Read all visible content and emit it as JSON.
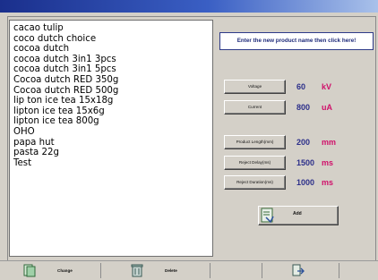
{
  "products": [
    "cacao tulip",
    "coco dutch choice",
    "cocoa dutch",
    "cocoa dutch 3in1 3pcs",
    "cocoa dutch 3in1 5pcs",
    "Cocoa dutch RED 350g",
    "Cocoa dutch RED 500g",
    "lip ton ice tea 15x18g",
    "lipton ice tea 15x6g",
    "lipton ice tea 800g",
    "OHO",
    "papa hut",
    "pasta 22g",
    "Test"
  ],
  "name_input": {
    "prompt": "Enter the new product name then click here!"
  },
  "params": {
    "voltage": {
      "label": "Voltage",
      "value": "60",
      "unit": "kV"
    },
    "current": {
      "label": "Current",
      "value": "800",
      "unit": "uA"
    },
    "product_length": {
      "label": "Product Length(mm)",
      "value": "200",
      "unit": "mm"
    },
    "reject_delay": {
      "label": "Reject Delay(ms)",
      "value": "1500",
      "unit": "ms"
    },
    "reject_duration": {
      "label": "Reject Duration(ms)",
      "value": "1000",
      "unit": "ms"
    }
  },
  "add_button": {
    "label": "Add",
    "icon": "add-product-icon"
  },
  "bottom": {
    "change": {
      "label": "Change",
      "icon": "change-icon"
    },
    "delete": {
      "label": "Delete",
      "icon": "trash-icon"
    },
    "exit": {
      "icon": "exit-icon"
    }
  },
  "colors": {
    "title_bar": "#1a2f8c",
    "value_text": "#2c2f8a",
    "unit_text": "#d0106a"
  }
}
